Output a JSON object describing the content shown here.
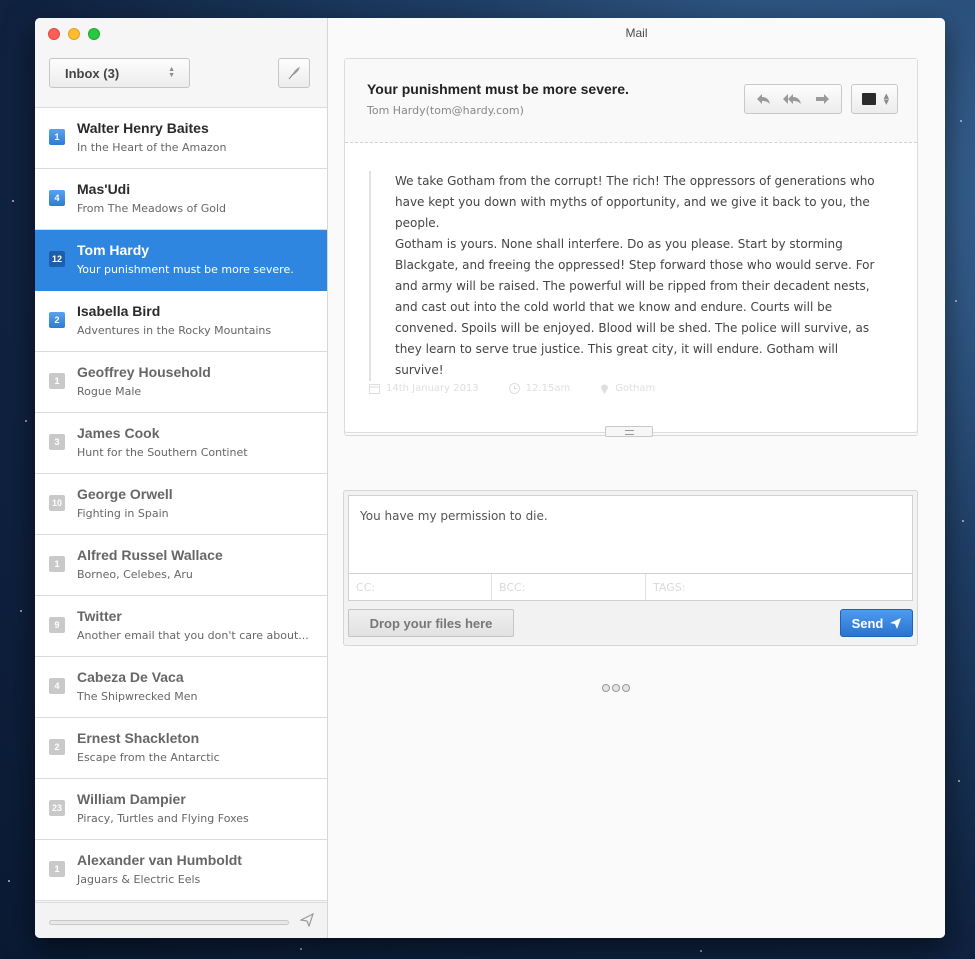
{
  "window": {
    "title": "Mail"
  },
  "sidebar": {
    "mailbox_select": "Inbox (3)",
    "messages": [
      {
        "sender": "Walter Henry Baites",
        "subject": "In the Heart of the Amazon",
        "count": "1",
        "unread": true
      },
      {
        "sender": "Mas'Udi",
        "subject": "From The Meadows of Gold",
        "count": "4",
        "unread": true
      },
      {
        "sender": "Tom Hardy",
        "subject": "Your punishment must be more severe.",
        "count": "12",
        "unread": true,
        "selected": true
      },
      {
        "sender": "Isabella Bird",
        "subject": "Adventures in the Rocky Mountains",
        "count": "2",
        "unread": true
      },
      {
        "sender": "Geoffrey Household",
        "subject": "Rogue Male",
        "count": "1",
        "unread": false
      },
      {
        "sender": "James Cook",
        "subject": "Hunt for the Southern Continet",
        "count": "3",
        "unread": false
      },
      {
        "sender": "George Orwell",
        "subject": "Fighting in Spain",
        "count": "10",
        "unread": false
      },
      {
        "sender": "Alfred Russel Wallace",
        "subject": "Borneo, Celebes, Aru",
        "count": "1",
        "unread": false
      },
      {
        "sender": "Twitter",
        "subject": "Another email that you don't care about...",
        "count": "9",
        "unread": false
      },
      {
        "sender": "Cabeza De Vaca",
        "subject": "The Shipwrecked Men",
        "count": "4",
        "unread": false
      },
      {
        "sender": "Ernest Shackleton",
        "subject": "Escape from the Antarctic",
        "count": "2",
        "unread": false
      },
      {
        "sender": "William Dampier",
        "subject": "Piracy, Turtles and Flying Foxes",
        "count": "23",
        "unread": false
      },
      {
        "sender": "Alexander van Humboldt",
        "subject": "Jaguars & Electric Eels",
        "count": "1",
        "unread": false
      }
    ]
  },
  "message": {
    "subject": "Your punishment must be more severe.",
    "from": "Tom Hardy(tom@hardy.com)",
    "body": [
      "We take Gotham from the corrupt! The rich! The oppressors of generations who have kept you down with myths of opportunity, and we give it back to you, the people.",
      "Gotham is yours. None shall interfere. Do as you please. Start by storming Blackgate, and freeing the oppressed! Step forward those who would serve. For and army will be raised. The powerful will be ripped from their decadent nests, and cast out into the cold world that we know and endure. Courts will be convened. Spoils will be enjoyed. Blood will be shed. The police will survive, as they learn to serve true justice. This great city, it will endure. Gotham will survive!"
    ],
    "date": "14th January 2013",
    "time": "12.15am",
    "location": "Gotham"
  },
  "reply": {
    "text": "You have my permission to die.",
    "cc_placeholder": "CC:",
    "bcc_placeholder": "BCC:",
    "tags_placeholder": "TAGS:",
    "drop_label": "Drop your files here",
    "send_label": "Send"
  },
  "colors": {
    "accent": "#2f86e0",
    "send": "#2a73d1"
  }
}
